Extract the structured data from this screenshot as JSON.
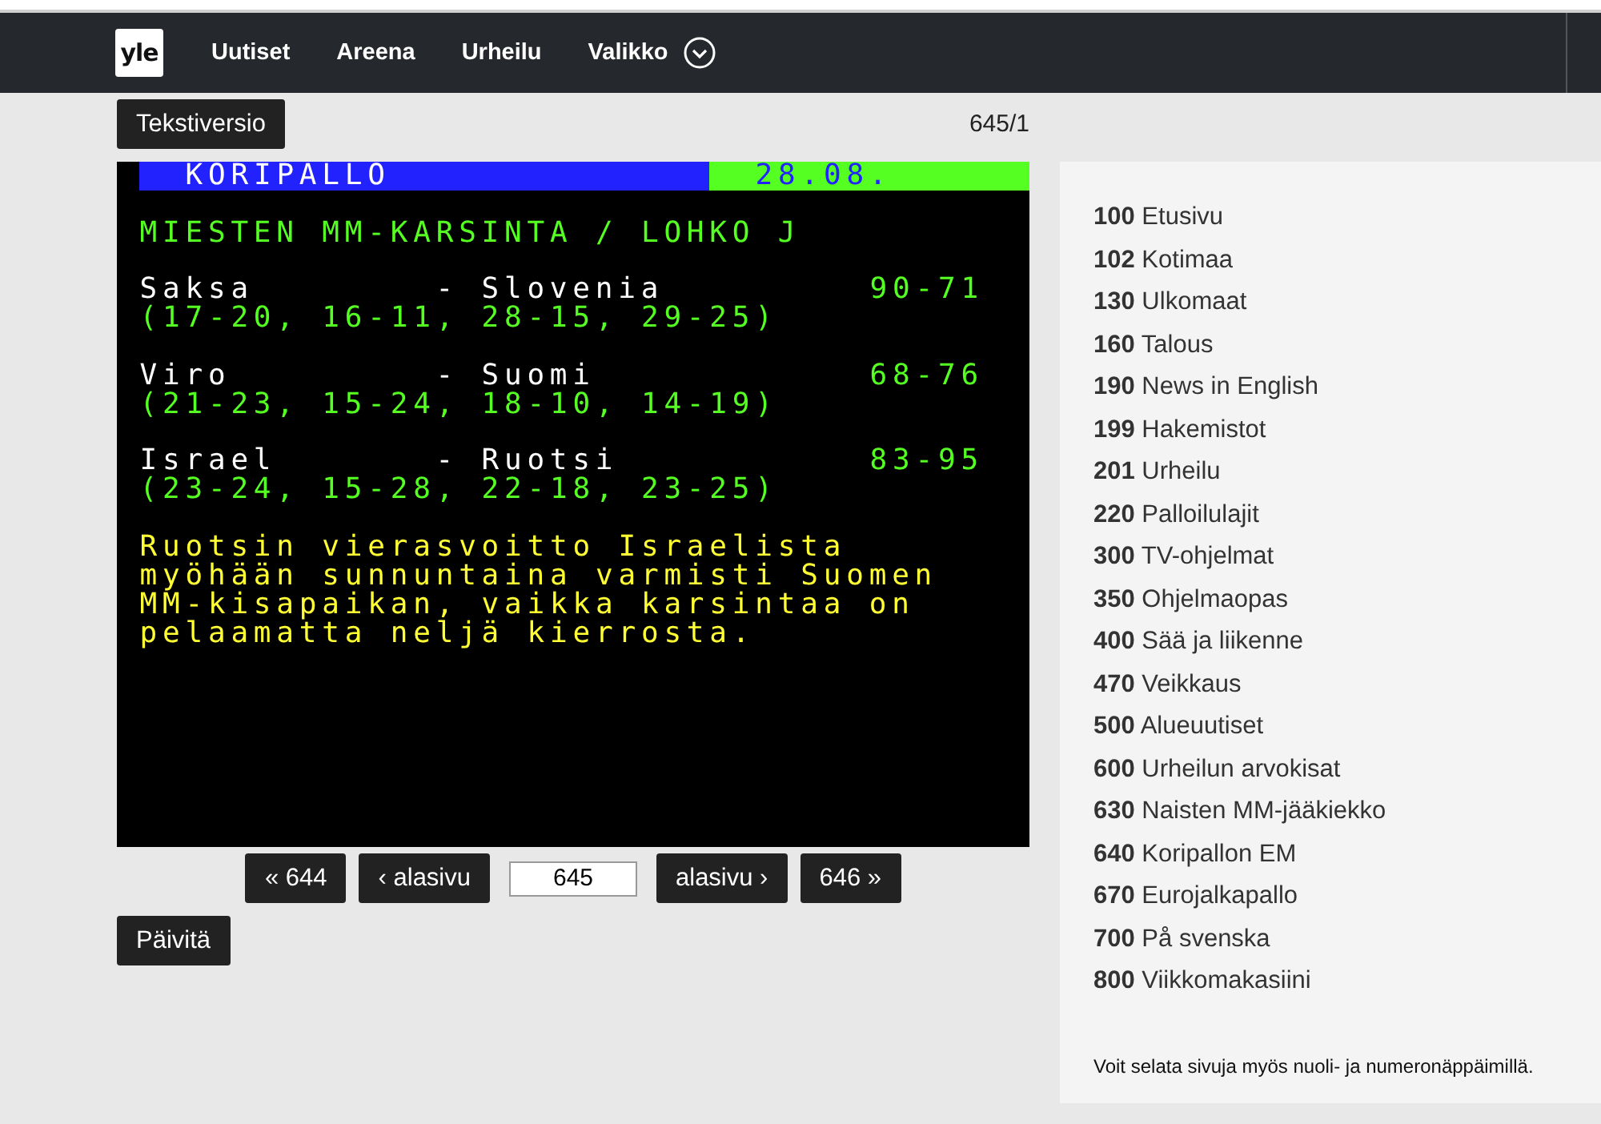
{
  "nav": {
    "logo": "yle",
    "items": [
      "Uutiset",
      "Areena",
      "Urheilu"
    ],
    "menu": "Valikko"
  },
  "toolbar": {
    "text_version_button": "Tekstiversio",
    "page_indicator": "645/1"
  },
  "teletext": {
    "section": "KORIPALLO",
    "date": "28.08.",
    "heading": "MIESTEN MM-KARSINTA / LOHKO J",
    "results": [
      {
        "home": "Saksa",
        "away": "- Slovenia",
        "score": "90-71",
        "periods": "(17-20, 16-11, 28-15, 29-25)"
      },
      {
        "home": "Viro",
        "away": "- Suomi",
        "score": "68-76",
        "periods": "(21-23, 15-24, 18-10, 14-19)"
      },
      {
        "home": "Israel",
        "away": "- Ruotsi",
        "score": "83-95",
        "periods": "(23-24, 15-28, 22-18, 23-25)"
      }
    ],
    "story_lines": [
      "Ruotsin vierasvoitto Israelista",
      "myöhään sunnuntaina varmisti Suomen",
      "MM-kisapaikan, vaikka karsintaa on",
      "pelaamatta neljä kierrosta."
    ]
  },
  "pager": {
    "prev_page": "« 644",
    "prev_subpage": "‹ alasivu",
    "page_value": "645",
    "next_subpage": "alasivu ›",
    "next_page": "646 »",
    "refresh": "Päivitä"
  },
  "index": {
    "items": [
      {
        "number": "100",
        "label": "Etusivu"
      },
      {
        "number": "102",
        "label": "Kotimaa"
      },
      {
        "number": "130",
        "label": "Ulkomaat"
      },
      {
        "number": "160",
        "label": "Talous"
      },
      {
        "number": "190",
        "label": "News in English"
      },
      {
        "number": "199",
        "label": "Hakemistot"
      },
      {
        "number": "201",
        "label": "Urheilu"
      },
      {
        "number": "220",
        "label": "Palloilulajit"
      },
      {
        "number": "300",
        "label": "TV-ohjelmat"
      },
      {
        "number": "350",
        "label": "Ohjelmaopas"
      },
      {
        "number": "400",
        "label": "Sää ja liikenne"
      },
      {
        "number": "470",
        "label": "Veikkaus"
      },
      {
        "number": "500",
        "label": "Alueuutiset"
      },
      {
        "number": "600",
        "label": "Urheilun arvokisat"
      },
      {
        "number": "630",
        "label": "Naisten MM-jääkiekko"
      },
      {
        "number": "640",
        "label": "Koripallon EM"
      },
      {
        "number": "670",
        "label": "Eurojalkapallo"
      },
      {
        "number": "700",
        "label": "På svenska"
      },
      {
        "number": "800",
        "label": "Viikkomakasiini"
      }
    ],
    "hint": "Voit selata sivuja myös nuoli- ja numeronäppäimillä."
  }
}
